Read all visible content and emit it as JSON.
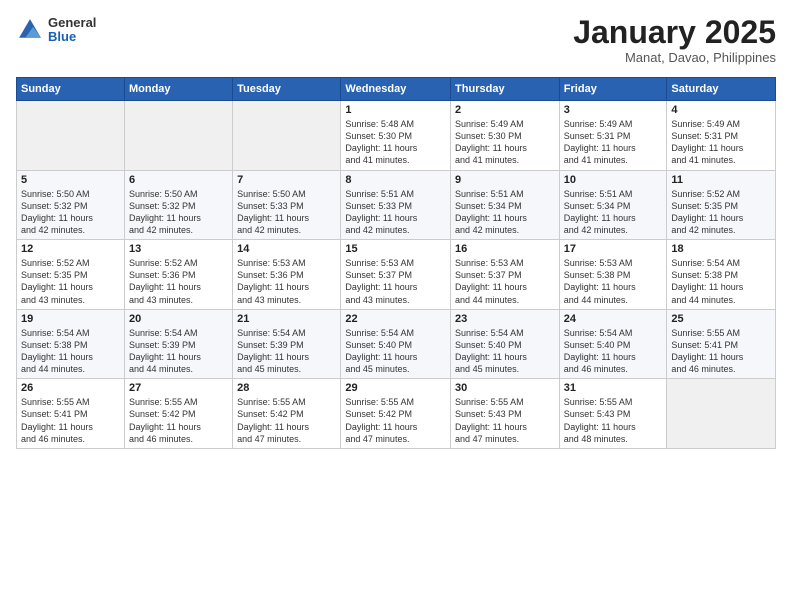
{
  "logo": {
    "general": "General",
    "blue": "Blue"
  },
  "header": {
    "title": "January 2025",
    "location": "Manat, Davao, Philippines"
  },
  "weekdays": [
    "Sunday",
    "Monday",
    "Tuesday",
    "Wednesday",
    "Thursday",
    "Friday",
    "Saturday"
  ],
  "weeks": [
    [
      {
        "day": "",
        "info": ""
      },
      {
        "day": "",
        "info": ""
      },
      {
        "day": "",
        "info": ""
      },
      {
        "day": "1",
        "info": "Sunrise: 5:48 AM\nSunset: 5:30 PM\nDaylight: 11 hours\nand 41 minutes."
      },
      {
        "day": "2",
        "info": "Sunrise: 5:49 AM\nSunset: 5:30 PM\nDaylight: 11 hours\nand 41 minutes."
      },
      {
        "day": "3",
        "info": "Sunrise: 5:49 AM\nSunset: 5:31 PM\nDaylight: 11 hours\nand 41 minutes."
      },
      {
        "day": "4",
        "info": "Sunrise: 5:49 AM\nSunset: 5:31 PM\nDaylight: 11 hours\nand 41 minutes."
      }
    ],
    [
      {
        "day": "5",
        "info": "Sunrise: 5:50 AM\nSunset: 5:32 PM\nDaylight: 11 hours\nand 42 minutes."
      },
      {
        "day": "6",
        "info": "Sunrise: 5:50 AM\nSunset: 5:32 PM\nDaylight: 11 hours\nand 42 minutes."
      },
      {
        "day": "7",
        "info": "Sunrise: 5:50 AM\nSunset: 5:33 PM\nDaylight: 11 hours\nand 42 minutes."
      },
      {
        "day": "8",
        "info": "Sunrise: 5:51 AM\nSunset: 5:33 PM\nDaylight: 11 hours\nand 42 minutes."
      },
      {
        "day": "9",
        "info": "Sunrise: 5:51 AM\nSunset: 5:34 PM\nDaylight: 11 hours\nand 42 minutes."
      },
      {
        "day": "10",
        "info": "Sunrise: 5:51 AM\nSunset: 5:34 PM\nDaylight: 11 hours\nand 42 minutes."
      },
      {
        "day": "11",
        "info": "Sunrise: 5:52 AM\nSunset: 5:35 PM\nDaylight: 11 hours\nand 42 minutes."
      }
    ],
    [
      {
        "day": "12",
        "info": "Sunrise: 5:52 AM\nSunset: 5:35 PM\nDaylight: 11 hours\nand 43 minutes."
      },
      {
        "day": "13",
        "info": "Sunrise: 5:52 AM\nSunset: 5:36 PM\nDaylight: 11 hours\nand 43 minutes."
      },
      {
        "day": "14",
        "info": "Sunrise: 5:53 AM\nSunset: 5:36 PM\nDaylight: 11 hours\nand 43 minutes."
      },
      {
        "day": "15",
        "info": "Sunrise: 5:53 AM\nSunset: 5:37 PM\nDaylight: 11 hours\nand 43 minutes."
      },
      {
        "day": "16",
        "info": "Sunrise: 5:53 AM\nSunset: 5:37 PM\nDaylight: 11 hours\nand 44 minutes."
      },
      {
        "day": "17",
        "info": "Sunrise: 5:53 AM\nSunset: 5:38 PM\nDaylight: 11 hours\nand 44 minutes."
      },
      {
        "day": "18",
        "info": "Sunrise: 5:54 AM\nSunset: 5:38 PM\nDaylight: 11 hours\nand 44 minutes."
      }
    ],
    [
      {
        "day": "19",
        "info": "Sunrise: 5:54 AM\nSunset: 5:38 PM\nDaylight: 11 hours\nand 44 minutes."
      },
      {
        "day": "20",
        "info": "Sunrise: 5:54 AM\nSunset: 5:39 PM\nDaylight: 11 hours\nand 44 minutes."
      },
      {
        "day": "21",
        "info": "Sunrise: 5:54 AM\nSunset: 5:39 PM\nDaylight: 11 hours\nand 45 minutes."
      },
      {
        "day": "22",
        "info": "Sunrise: 5:54 AM\nSunset: 5:40 PM\nDaylight: 11 hours\nand 45 minutes."
      },
      {
        "day": "23",
        "info": "Sunrise: 5:54 AM\nSunset: 5:40 PM\nDaylight: 11 hours\nand 45 minutes."
      },
      {
        "day": "24",
        "info": "Sunrise: 5:54 AM\nSunset: 5:40 PM\nDaylight: 11 hours\nand 46 minutes."
      },
      {
        "day": "25",
        "info": "Sunrise: 5:55 AM\nSunset: 5:41 PM\nDaylight: 11 hours\nand 46 minutes."
      }
    ],
    [
      {
        "day": "26",
        "info": "Sunrise: 5:55 AM\nSunset: 5:41 PM\nDaylight: 11 hours\nand 46 minutes."
      },
      {
        "day": "27",
        "info": "Sunrise: 5:55 AM\nSunset: 5:42 PM\nDaylight: 11 hours\nand 46 minutes."
      },
      {
        "day": "28",
        "info": "Sunrise: 5:55 AM\nSunset: 5:42 PM\nDaylight: 11 hours\nand 47 minutes."
      },
      {
        "day": "29",
        "info": "Sunrise: 5:55 AM\nSunset: 5:42 PM\nDaylight: 11 hours\nand 47 minutes."
      },
      {
        "day": "30",
        "info": "Sunrise: 5:55 AM\nSunset: 5:43 PM\nDaylight: 11 hours\nand 47 minutes."
      },
      {
        "day": "31",
        "info": "Sunrise: 5:55 AM\nSunset: 5:43 PM\nDaylight: 11 hours\nand 48 minutes."
      },
      {
        "day": "",
        "info": ""
      }
    ]
  ]
}
